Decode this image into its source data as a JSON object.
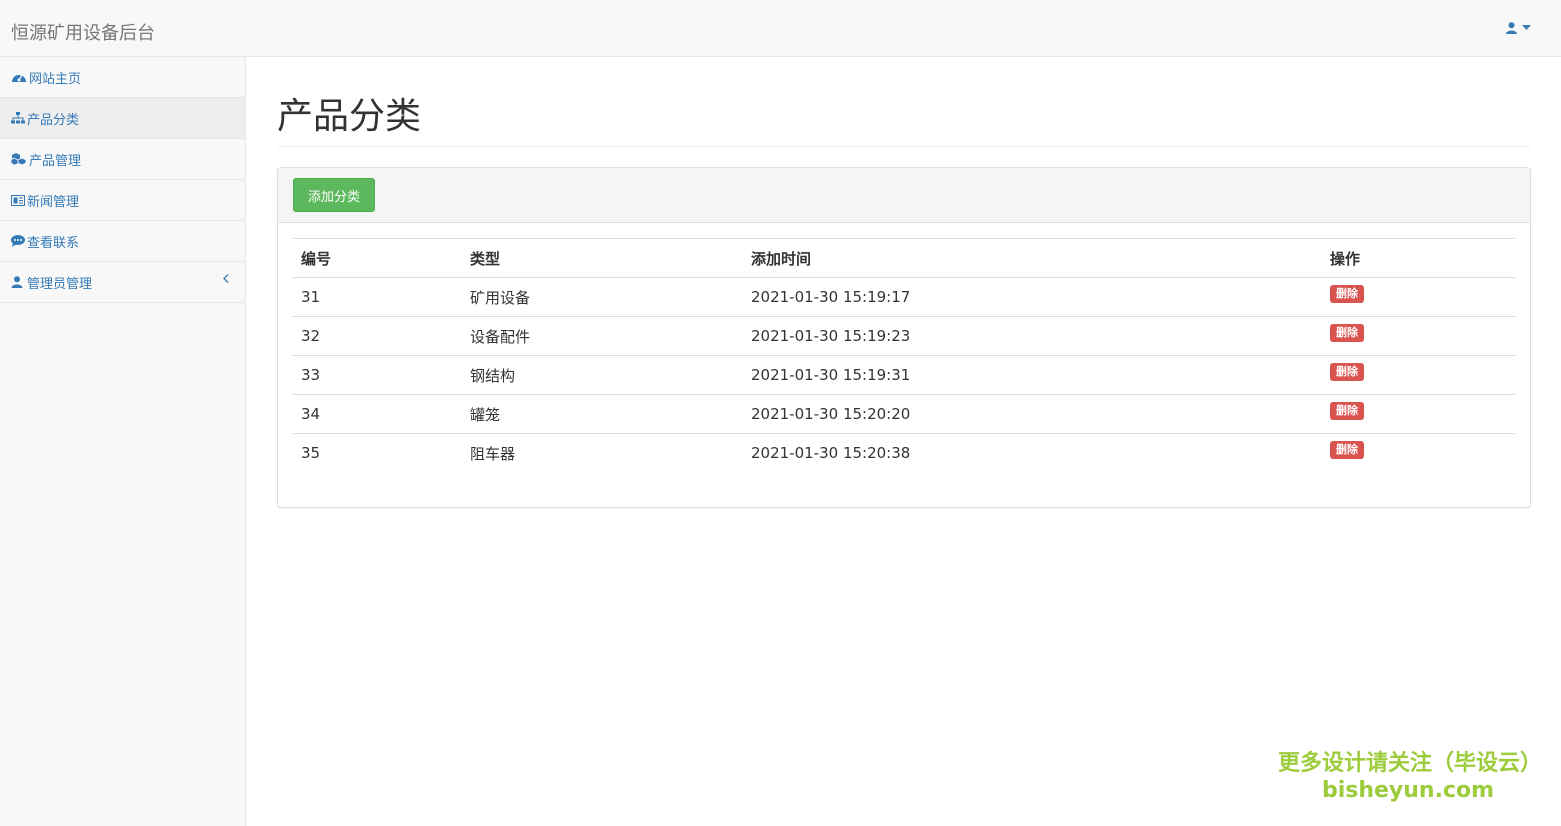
{
  "app": {
    "brand": "恒源矿用设备后台"
  },
  "sidebar": {
    "items": [
      {
        "label": "网站主页",
        "icon": "dashboard-icon"
      },
      {
        "label": "产品分类",
        "icon": "sitemap-icon"
      },
      {
        "label": "产品管理",
        "icon": "cubes-icon"
      },
      {
        "label": "新闻管理",
        "icon": "newspaper-icon"
      },
      {
        "label": "查看联系",
        "icon": "comment-icon"
      },
      {
        "label": "管理员管理",
        "icon": "user-icon"
      }
    ]
  },
  "main": {
    "title": "产品分类",
    "add_button": "添加分类",
    "table": {
      "headers": [
        "编号",
        "类型",
        "添加时间",
        "操作"
      ],
      "rows": [
        {
          "id": "31",
          "type": "矿用设备",
          "time": "2021-01-30 15:19:17",
          "action": "删除"
        },
        {
          "id": "32",
          "type": "设备配件",
          "time": "2021-01-30 15:19:23",
          "action": "删除"
        },
        {
          "id": "33",
          "type": "钢结构",
          "time": "2021-01-30 15:19:31",
          "action": "删除"
        },
        {
          "id": "34",
          "type": "罐笼",
          "time": "2021-01-30 15:20:20",
          "action": "删除"
        },
        {
          "id": "35",
          "type": "阻车器",
          "time": "2021-01-30 15:20:38",
          "action": "删除"
        }
      ]
    }
  },
  "watermark": {
    "line1": "更多设计请关注（毕设云）",
    "line2": "bisheyun.com"
  },
  "colors": {
    "link": "#337ab7",
    "success": "#5cb85c",
    "danger": "#d9534f"
  }
}
